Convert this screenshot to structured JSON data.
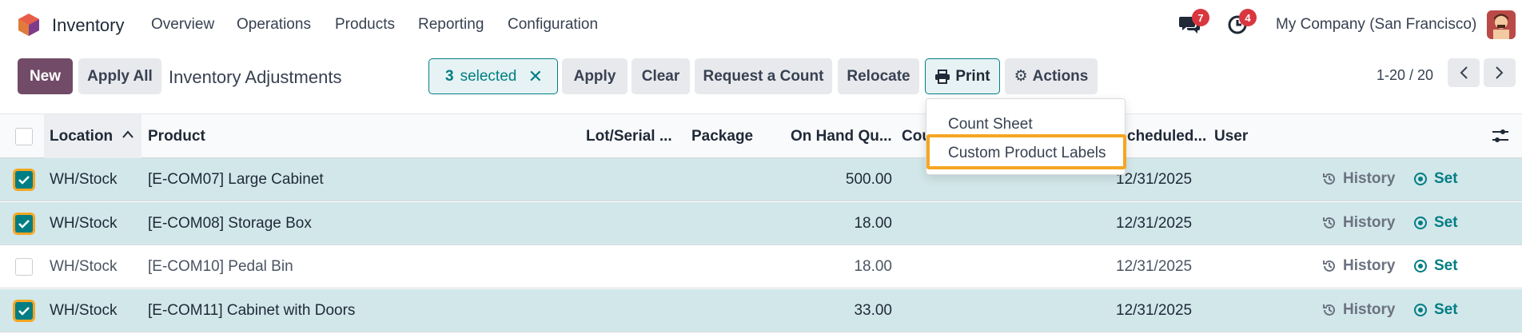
{
  "app": {
    "name": "Inventory",
    "company": "My Company (San Francisco)"
  },
  "menu": [
    "Overview",
    "Operations",
    "Products",
    "Reporting",
    "Configuration"
  ],
  "systray": {
    "messages_count": "7",
    "activities_count": "4"
  },
  "toolbar": {
    "new_label": "New",
    "apply_all_label": "Apply All",
    "title": "Inventory Adjustments",
    "selected_count": "3",
    "selected_label": "selected",
    "apply_label": "Apply",
    "clear_label": "Clear",
    "request_count_label": "Request a Count",
    "relocate_label": "Relocate",
    "print_label": "Print",
    "actions_label": "Actions"
  },
  "pager": {
    "range": "1-20 / 20"
  },
  "print_menu": {
    "items": [
      "Count Sheet",
      "Custom Product Labels"
    ],
    "highlighted": "Custom Product Labels"
  },
  "table": {
    "headers": {
      "location": "Location",
      "product": "Product",
      "lot": "Lot/Serial ...",
      "package": "Package",
      "on_hand": "On Hand Qu...",
      "counted": "Cou",
      "scheduled": "cheduled...",
      "user": "User"
    },
    "row_actions": {
      "history": "History",
      "set": "Set"
    },
    "rows": [
      {
        "selected": true,
        "location": "WH/Stock",
        "product": "[E-COM07] Large Cabinet",
        "on_hand": "500.00",
        "scheduled": "12/31/2025"
      },
      {
        "selected": true,
        "location": "WH/Stock",
        "product": "[E-COM08] Storage Box",
        "on_hand": "18.00",
        "scheduled": "12/31/2025"
      },
      {
        "selected": false,
        "location": "WH/Stock",
        "product": "[E-COM10] Pedal Bin",
        "on_hand": "18.00",
        "scheduled": "12/31/2025"
      },
      {
        "selected": true,
        "location": "WH/Stock",
        "product": "[E-COM11] Cabinet with Doors",
        "on_hand": "33.00",
        "scheduled": "12/31/2025"
      }
    ]
  },
  "colors": {
    "brand": "#714b67",
    "accent": "#017e84",
    "highlight": "#f5a623",
    "selected_row": "#d2e7ea",
    "badge": "#d9373f"
  }
}
